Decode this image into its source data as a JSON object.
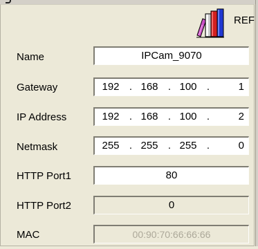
{
  "header": {
    "ref_label": "REF",
    "icon": "books-icon"
  },
  "form": {
    "name": {
      "label": "Name",
      "value": "IPCam_9070"
    },
    "gateway": {
      "label": "Gateway",
      "octets": [
        "192",
        "168",
        "100",
        "1"
      ],
      "separator": "."
    },
    "ip_address": {
      "label": "IP Address",
      "octets": [
        "192",
        "168",
        "100",
        "2"
      ],
      "separator": "."
    },
    "netmask": {
      "label": "Netmask",
      "octets": [
        "255",
        "255",
        "255",
        "0"
      ],
      "separator": "."
    },
    "http_port1": {
      "label": "HTTP Port1",
      "value": "80"
    },
    "http_port2": {
      "label": "HTTP Port2",
      "value": "0"
    },
    "mac": {
      "label": "MAC",
      "value": "00:90:70:66:66:66"
    }
  }
}
